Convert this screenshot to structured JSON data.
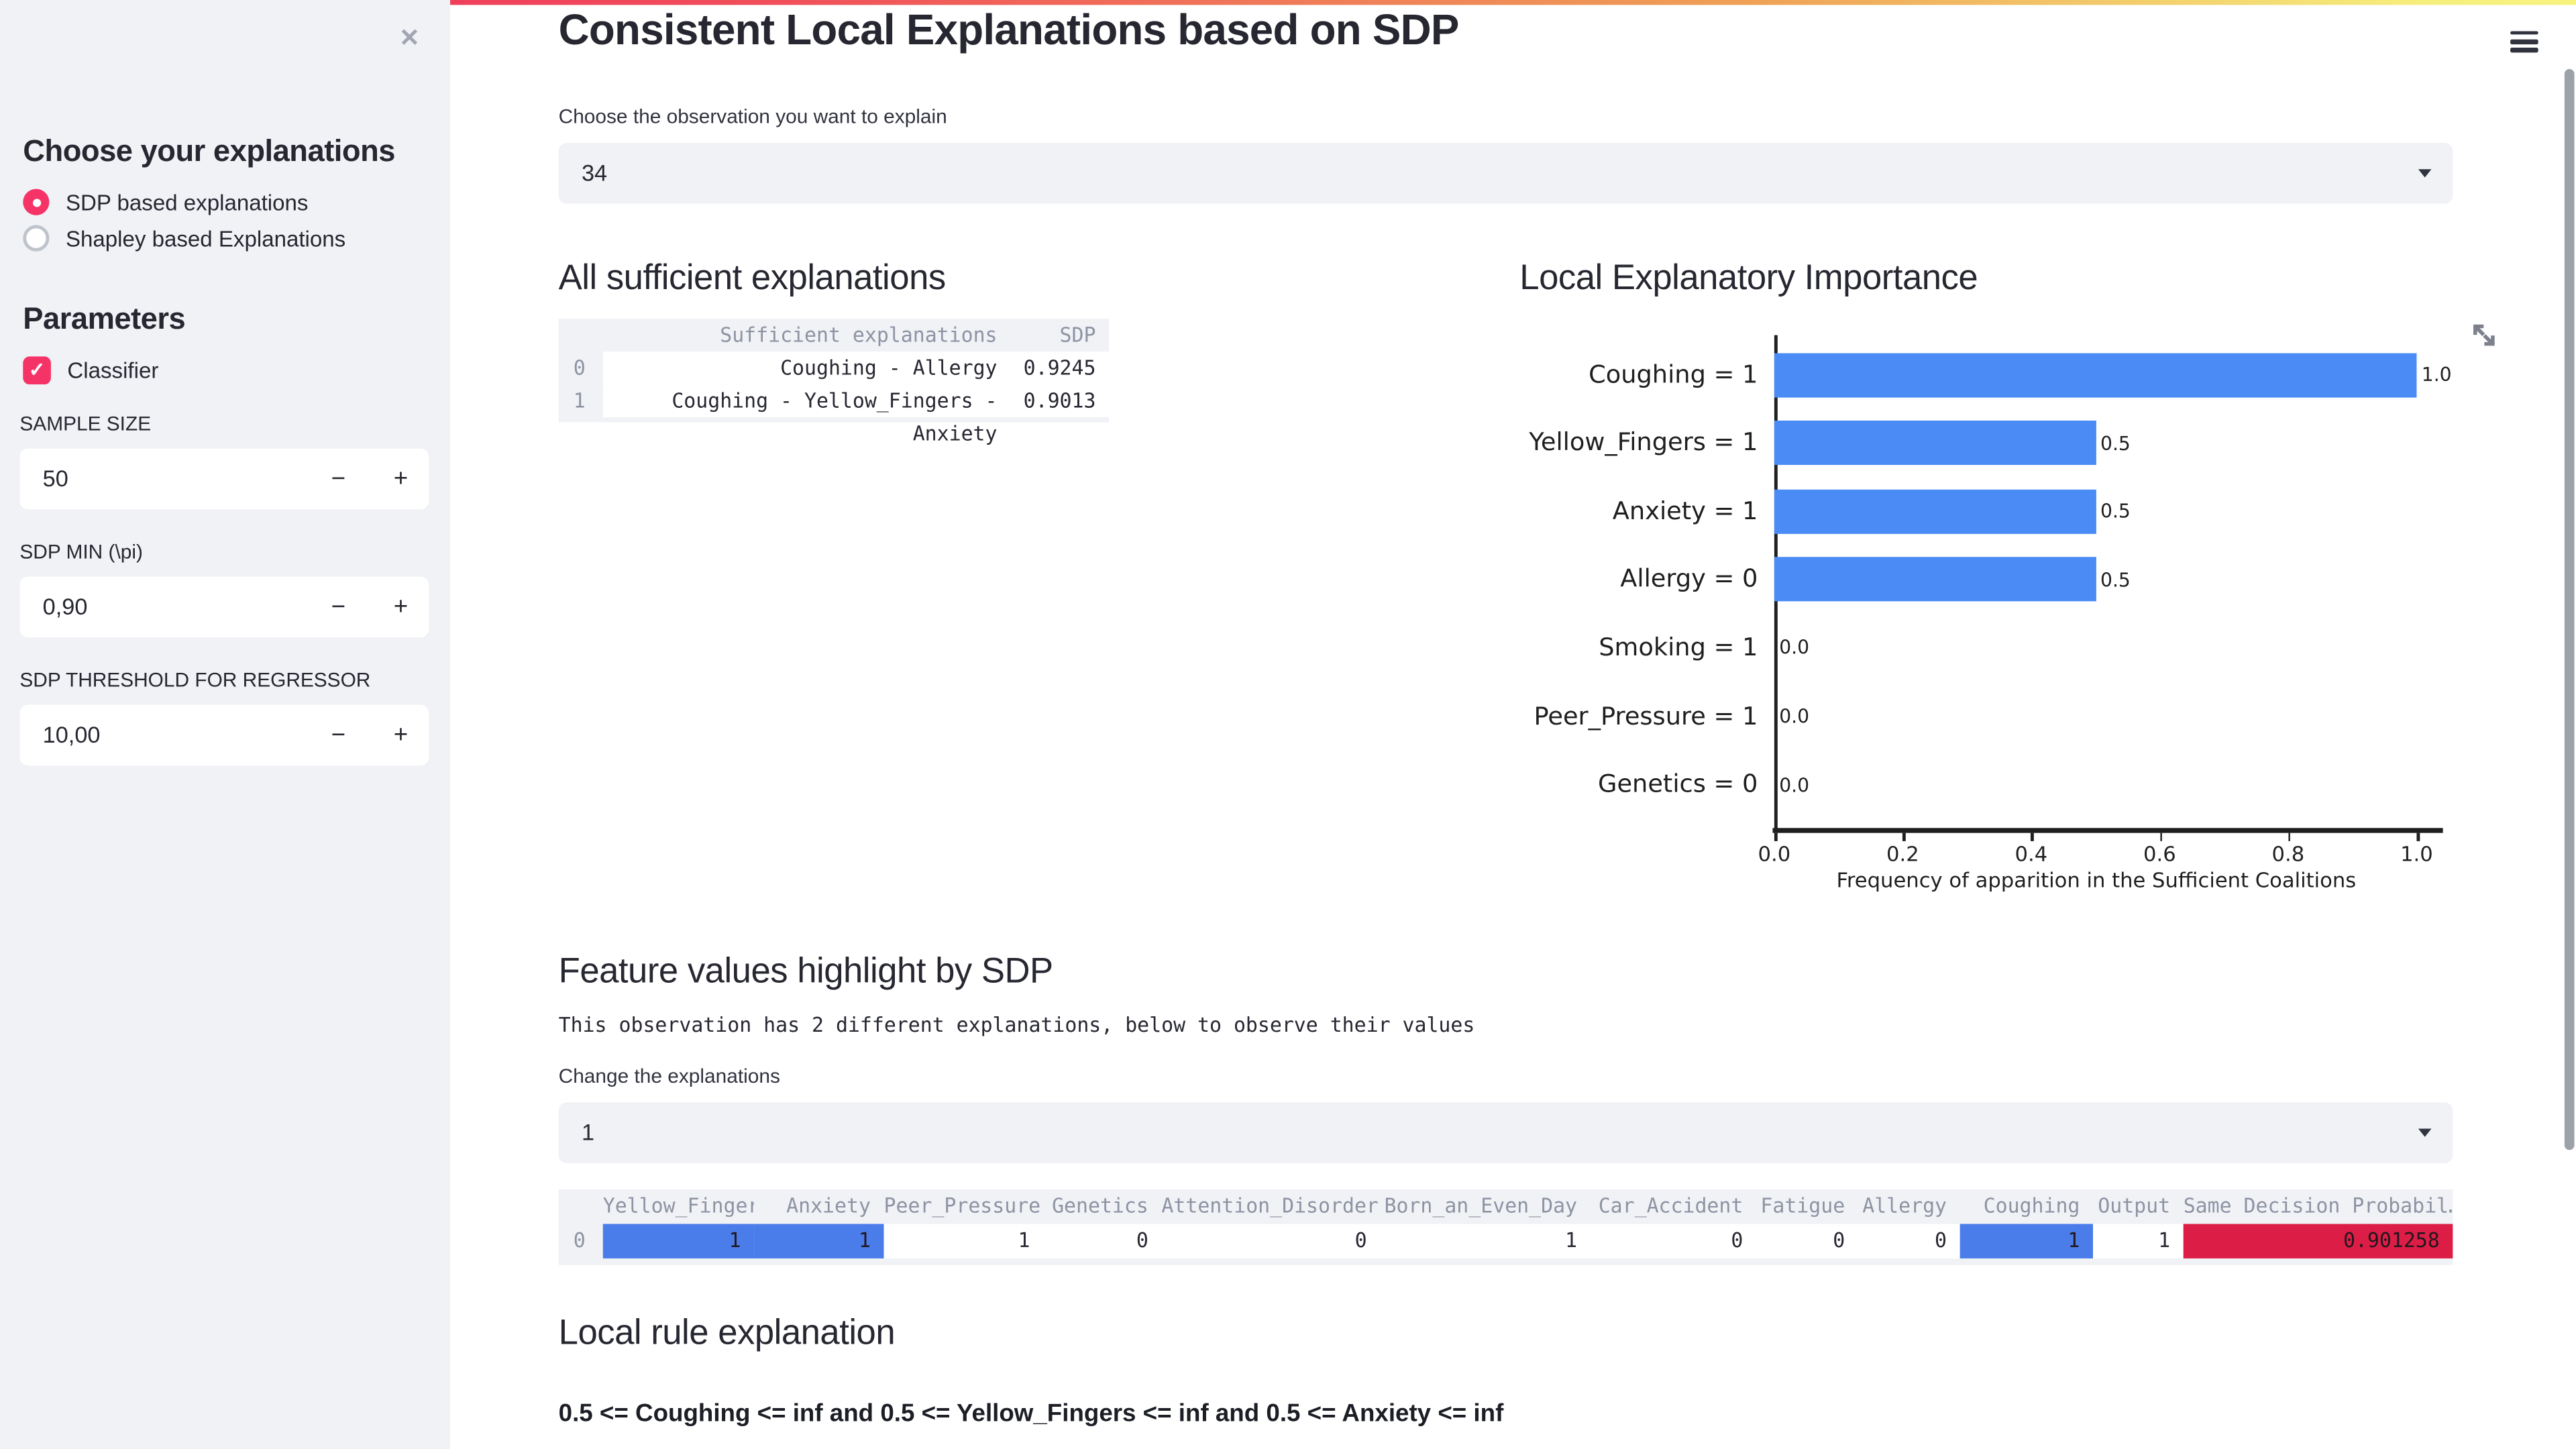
{
  "colors": {
    "accent": "#f63366",
    "bar_blue": "#4b8bf5",
    "highlight_blue": "#4a7de9",
    "highlight_red": "#dc1e47",
    "highlight_text_dark": "#23161d"
  },
  "sidebar": {
    "close_icon": "✕",
    "section_explanations_title": "Choose your explanations",
    "radios": [
      {
        "label": "SDP based explanations",
        "selected": true
      },
      {
        "label": "Shapley based Explanations",
        "selected": false
      }
    ],
    "section_parameters_title": "Parameters",
    "checkbox": {
      "label": "Classifier",
      "checked": true,
      "check_glyph": "✓"
    },
    "fields": [
      {
        "label": "SAMPLE SIZE",
        "value": "50"
      },
      {
        "label": "SDP MIN (\\pi)",
        "value": "0,90"
      },
      {
        "label": "SDP THRESHOLD FOR REGRESSOR",
        "value": "10,00"
      }
    ],
    "stepper": {
      "minus": "−",
      "plus": "+"
    }
  },
  "main": {
    "title": "Consistent Local Explanations based on SDP",
    "observation_select": {
      "label": "Choose the observation you want to explain",
      "value": "34"
    },
    "sufficient": {
      "title": "All sufficient explanations",
      "headers": {
        "explanation": "Sufficient explanations",
        "sdp": "SDP"
      },
      "rows": [
        {
          "index": "0",
          "explanation": "Coughing - Allergy",
          "sdp": "0.9245"
        },
        {
          "index": "1",
          "explanation": "Coughing - Yellow_Fingers - Anxiety",
          "sdp": "0.9013"
        }
      ]
    },
    "feature_section": {
      "title": "Feature values highlight by SDP",
      "note": "This observation has 2 different explanations, below to observe their values",
      "select_label": "Change the explanations",
      "select_value": "1"
    },
    "feature_table": {
      "index": "0",
      "columns": [
        {
          "label": "Yellow_Fingers",
          "value": "1",
          "highlight": "blue"
        },
        {
          "label": "Anxiety",
          "value": "1",
          "highlight": "blue"
        },
        {
          "label": "Peer_Pressure",
          "value": "1",
          "highlight": "none"
        },
        {
          "label": "Genetics",
          "value": "0",
          "highlight": "none"
        },
        {
          "label": "Attention_Disorder",
          "value": "0",
          "highlight": "none"
        },
        {
          "label": "Born_an_Even_Day",
          "value": "1",
          "highlight": "none"
        },
        {
          "label": "Car_Accident",
          "value": "0",
          "highlight": "none"
        },
        {
          "label": "Fatigue",
          "value": "0",
          "highlight": "none"
        },
        {
          "label": "Allergy",
          "value": "0",
          "highlight": "none"
        },
        {
          "label": "Coughing",
          "value": "1",
          "highlight": "blue"
        },
        {
          "label": "Output",
          "value": "1",
          "highlight": "none"
        },
        {
          "label": "Same Decision Probabil…",
          "value": "0.901258",
          "highlight": "red"
        }
      ]
    },
    "rule": {
      "title": "Local rule explanation",
      "text": "0.5 <= Coughing <= inf and 0.5 <= Yellow_Fingers <= inf and 0.5 <= Anxiety <= inf"
    }
  },
  "chart_data": {
    "type": "bar",
    "orientation": "horizontal",
    "title": "Local Explanatory Importance",
    "categories": [
      "Coughing = 1",
      "Yellow_Fingers = 1",
      "Anxiety = 1",
      "Allergy = 0",
      "Smoking = 1",
      "Peer_Pressure = 1",
      "Genetics = 0"
    ],
    "values": [
      1.0,
      0.5,
      0.5,
      0.5,
      0.0,
      0.0,
      0.0
    ],
    "value_labels": [
      "1.0",
      "0.5",
      "0.5",
      "0.5",
      "0.0",
      "0.0",
      "0.0"
    ],
    "xlabel": "Frequency of apparition in the Sufficient Coalitions",
    "x_ticks": [
      0.0,
      0.2,
      0.4,
      0.6,
      0.8,
      1.0
    ],
    "x_tick_labels": [
      "0.0",
      "0.2",
      "0.4",
      "0.6",
      "0.8",
      "1.0"
    ],
    "xlim": [
      0.0,
      1.05
    ],
    "grid": false,
    "legend": "none",
    "bar_color": "#4b8bf5"
  }
}
